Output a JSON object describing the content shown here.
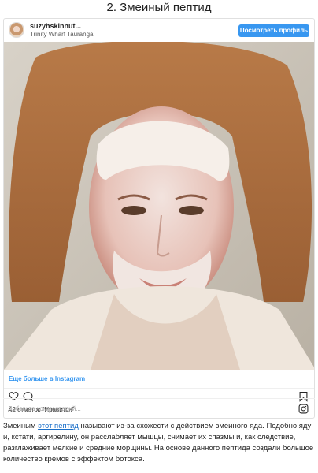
{
  "heading": "2. Змеиный пептид",
  "post": {
    "username": "suzyhskinnut...",
    "location": "Trinity Wharf Tauranga",
    "view_profile_label": "Посмотреть профиль",
    "more_link": "Еще больше в Instagram",
    "likes": "42 отметок \"Нравится\"",
    "comment_placeholder": "Добавьте комментарий...",
    "photo_alt": "Selfie of a woman with a white clay face mask"
  },
  "article": {
    "text_before": "Змеиным ",
    "link_text": "этот пептид",
    "text_after": " называют из-за схожести с действием змеиного яда. Подобно яду и, кстати, аргирелину, он расслабляет мышцы, снимает их спазмы и, как следствие, разглаживает мелкие и средние морщины. На основе данного пептида создали большое количество кремов с эффектом ботокса."
  },
  "colors": {
    "accent": "#3897f0",
    "link": "#1a6fc9"
  }
}
